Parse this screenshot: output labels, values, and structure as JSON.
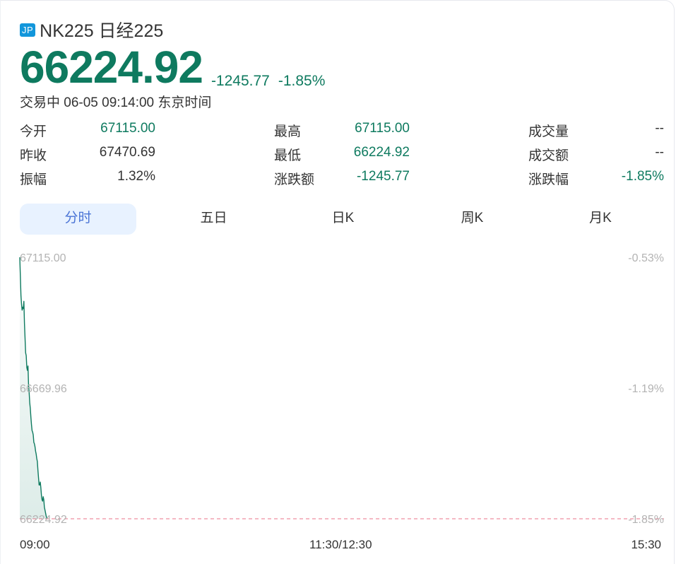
{
  "header": {
    "badge": "JP",
    "title": "NK225 日经225",
    "price": "66224.92",
    "change": "-1245.77",
    "change_pct": "-1.85%",
    "status": "交易中 06-05 09:14:00 东京时间"
  },
  "stats": {
    "open": {
      "label": "今开",
      "value": "67115.00"
    },
    "prev_close": {
      "label": "昨收",
      "value": "67470.69"
    },
    "amplitude": {
      "label": "振幅",
      "value": "1.32%"
    },
    "high": {
      "label": "最高",
      "value": "67115.00"
    },
    "low": {
      "label": "最低",
      "value": "66224.92"
    },
    "change_amt": {
      "label": "涨跌额",
      "value": "-1245.77"
    },
    "volume": {
      "label": "成交量",
      "value": "--"
    },
    "turnover": {
      "label": "成交额",
      "value": "--"
    },
    "change_pct": {
      "label": "涨跌幅",
      "value": "-1.85%"
    }
  },
  "tabs": [
    {
      "label": "分时",
      "active": true
    },
    {
      "label": "五日",
      "active": false
    },
    {
      "label": "日K",
      "active": false
    },
    {
      "label": "周K",
      "active": false
    },
    {
      "label": "月K",
      "active": false
    }
  ],
  "colors": {
    "down": "#0e7a5f",
    "accent": "#4a74d6",
    "badge": "#1296db",
    "baseline": "#ef8fa0"
  },
  "chart_data": {
    "type": "line",
    "x_range": [
      "09:00",
      "15:30"
    ],
    "x_ticks": [
      "09:00",
      "11:30/12:30",
      "15:30"
    ],
    "y_ticks_left": [
      "67115.00",
      "66669.96",
      "66224.92"
    ],
    "y_ticks_right": [
      "-0.53%",
      "-1.19%",
      "-1.85%"
    ],
    "ylim": [
      66224.92,
      67115.0
    ],
    "baseline_value": 66224.92,
    "x_minutes": [
      0,
      0.3,
      0.6,
      0.9,
      1.2,
      1.5,
      1.8,
      2.1,
      2.4,
      2.7,
      3.0,
      3.3,
      3.6,
      3.9,
      4.2,
      4.5,
      4.8,
      5.1,
      5.4,
      5.7,
      6.0,
      6.3,
      6.6,
      6.9,
      7.2,
      7.5,
      7.8,
      8.1,
      8.4,
      8.7,
      9.0,
      9.3,
      9.6,
      9.9,
      10.2,
      10.5,
      10.8,
      11.1,
      11.4,
      11.7,
      12.0,
      12.3,
      12.6,
      12.9,
      13.2,
      13.5,
      13.8,
      14.0
    ],
    "values": [
      67115.0,
      67050,
      66985,
      66955,
      66935,
      66945,
      66940,
      66965,
      66890,
      66840,
      66790,
      66780,
      66740,
      66730,
      66745,
      66680,
      66655,
      66620,
      66600,
      66570,
      66545,
      66525,
      66520,
      66510,
      66485,
      66480,
      66470,
      66455,
      66445,
      66430,
      66420,
      66390,
      66365,
      66340,
      66340,
      66350,
      66330,
      66305,
      66290,
      66285,
      66300,
      66290,
      66265,
      66255,
      66245,
      66235,
      66228,
      66224.92
    ]
  }
}
